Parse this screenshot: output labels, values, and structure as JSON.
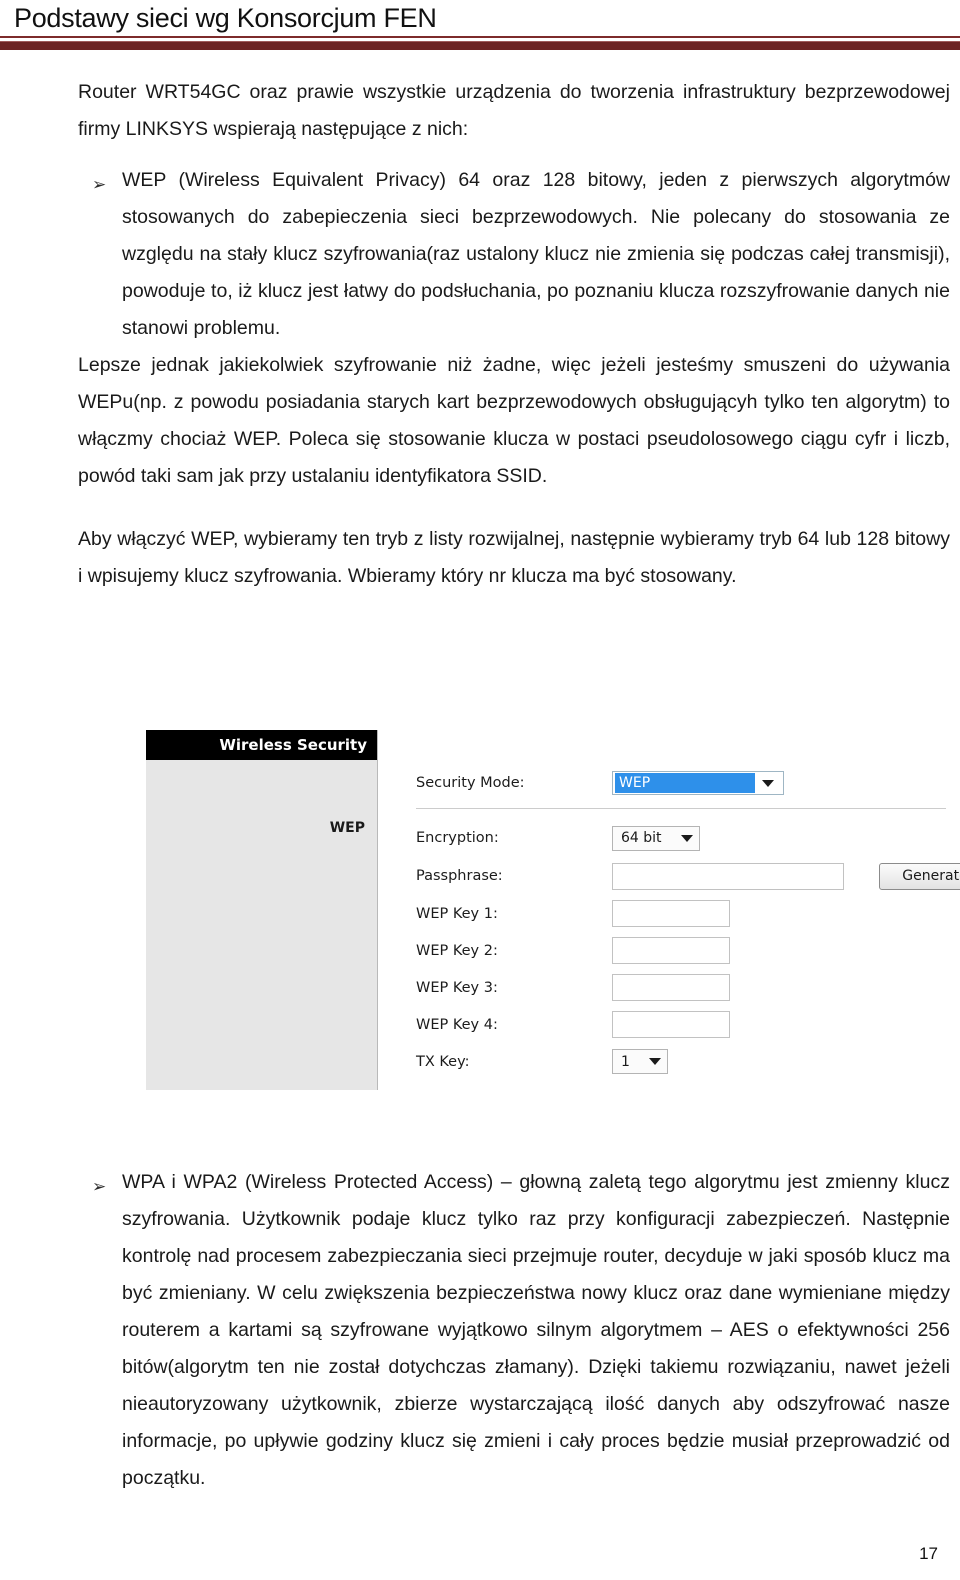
{
  "header": {
    "title": "Podstawy sieci wg Konsorcjum FEN",
    "rule_color_thin": "#7d2b2b",
    "rule_color_thick": "#6d2323"
  },
  "intro": {
    "paragraph": "Router WRT54GC oraz prawie wszystkie urządzenia do tworzenia infrastruktury bezprzewodowej firmy LINKSYS wspierają następujące z nich:"
  },
  "bullets": [
    {
      "glyph": "➢",
      "text": "WEP (Wireless Equivalent Privacy) 64 oraz 128 bitowy, jeden z pierwszych algorytmów stosowanych do zabepieczenia sieci bezprzewodowych. Nie polecany do stosowania ze względu na stały klucz szyfrowania(raz ustalony klucz nie zmienia się podczas całej transmisji), powoduje to, iż klucz jest łatwy do podsłuchania, po poznaniu klucza rozszyfrowanie danych nie stanowi problemu."
    },
    {
      "glyph": "➢",
      "text": "WPA i WPA2 (Wireless Protected Access) – głowną zaletą tego algorytmu jest zmienny klucz szyfrowania. Użytkownik podaje klucz tylko raz przy konfiguracji zabezpieczeń. Następnie kontrolę nad procesem zabezpieczania sieci przejmuje router, decyduje w jaki sposób klucz ma być zmieniany. W celu zwiększenia bezpieczeństwa nowy klucz oraz dane wymieniane między routerem a kartami są szyfrowane wyjątkowo silnym algorytmem – AES o efektywności 256 bitów(algorytm ten nie został dotychczas złamany). Dzięki takiemu rozwiązaniu, nawet jeżeli nieautoryzowany użytkownik, zbierze wystarczającą ilość danych aby odszyfrować nasze informacje, po upływie godziny klucz się zmieni i cały proces będzie musiał przeprowadzić od początku."
    }
  ],
  "paragraphs": {
    "wep_continued": "Lepsze jednak jakiekolwiek szyfrowanie niż żadne, więc jeżeli jesteśmy smuszeni do używania WEPu(np. z powodu posiadania starych kart bezprzewodowych obsługującyh tylko ten algorytm) to włączmy chociaż WEP. Poleca się stosowanie klucza w postaci pseudolosowego ciągu cyfr i liczb, powód taki sam jak przy ustalaniu identyfikatora SSID.",
    "how_to_enable": "Aby włączyć WEP, wybieramy ten tryb z listy rozwijalnej, następnie wybieramy tryb 64 lub 128 bitowy i wpisujemy klucz szyfrowania. Wbieramy który nr klucza ma być stosowany."
  },
  "router_ui": {
    "panel_title": "Wireless Security",
    "sidebar_label": "WEP",
    "accent_select_color": "#2e90ea",
    "fields": {
      "security_mode_label": "Security Mode:",
      "security_mode_value": "WEP",
      "encryption_label": "Encryption:",
      "encryption_value": "64 bit",
      "passphrase_label": "Passphrase:",
      "passphrase_value": "",
      "generate_button": "Generate",
      "wep_key_1_label": "WEP Key 1:",
      "wep_key_1_value": "",
      "wep_key_2_label": "WEP Key 2:",
      "wep_key_2_value": "",
      "wep_key_3_label": "WEP Key 3:",
      "wep_key_3_value": "",
      "wep_key_4_label": "WEP Key 4:",
      "wep_key_4_value": "",
      "tx_key_label": "TX Key:",
      "tx_key_value": "1"
    }
  },
  "footer": {
    "page_number": "17"
  }
}
